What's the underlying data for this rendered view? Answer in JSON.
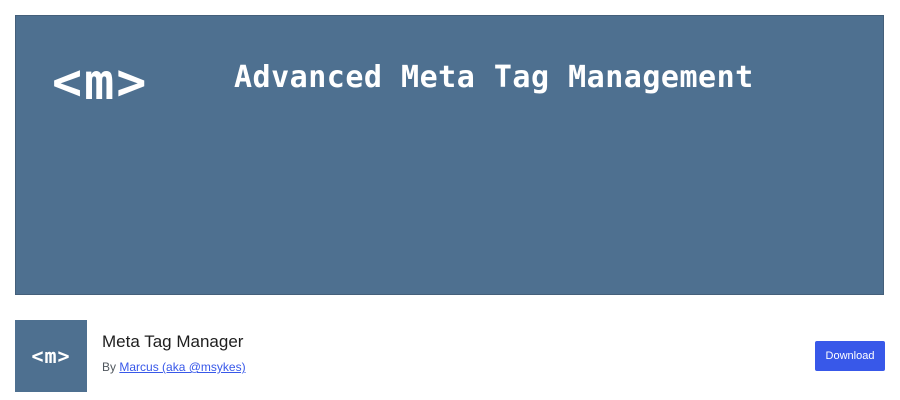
{
  "banner": {
    "logo_text": "<m>",
    "title": "Advanced Meta Tag Management",
    "background_color": "#4e7090"
  },
  "plugin": {
    "icon_text": "<m>",
    "name": "Meta Tag Manager",
    "author_prefix": "By",
    "author_name": "Marcus (aka @msykes)"
  },
  "actions": {
    "download_label": "Download",
    "accent_color": "#3858e9"
  }
}
